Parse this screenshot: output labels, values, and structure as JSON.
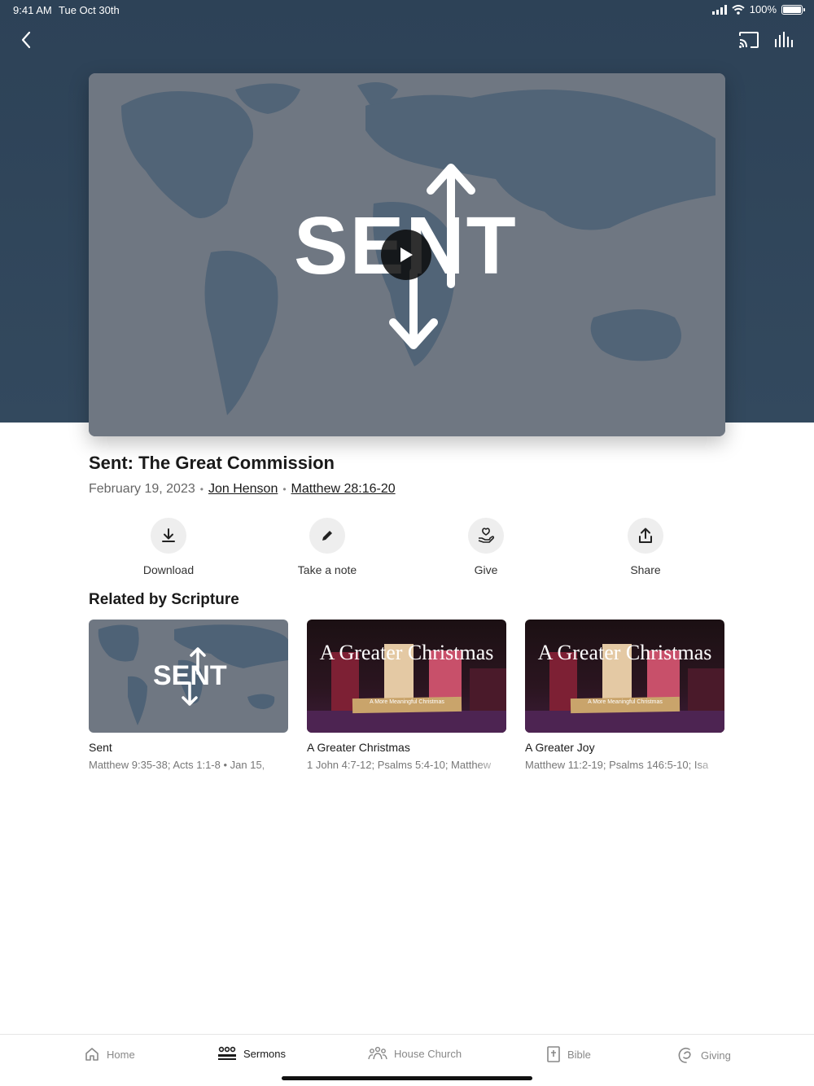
{
  "status": {
    "time": "9:41 AM",
    "date": "Tue Oct 30th",
    "battery": "100%"
  },
  "hero": {
    "artwork_text": "SENT",
    "play_icon": "play-icon"
  },
  "sermon": {
    "title": "Sent: The Great Commission",
    "date": "February 19, 2023",
    "speaker": "Jon Henson",
    "scripture": "Matthew 28:16-20"
  },
  "actions": [
    {
      "label": "Download",
      "icon": "download-icon"
    },
    {
      "label": "Take a note",
      "icon": "pencil-icon"
    },
    {
      "label": "Give",
      "icon": "give-icon"
    },
    {
      "label": "Share",
      "icon": "share-icon"
    }
  ],
  "related": {
    "heading": "Related by Scripture",
    "items": [
      {
        "title": "Sent",
        "subtitle": "Matthew 9:35-38; Acts 1:1-8 • Jan 15,",
        "art_text": "SENT"
      },
      {
        "title": "A Greater Christmas",
        "subtitle": "1 John 4:7-12; Psalms 5:4-10; Matthew",
        "art_title": "A Greater Christmas",
        "art_sub": "A More Meaningful Christmas"
      },
      {
        "title": "A Greater Joy",
        "subtitle": "Matthew 11:2-19; Psalms 146:5-10; Isa",
        "art_title": "A Greater Christmas",
        "art_sub": "A More Meaningful Christmas"
      }
    ]
  },
  "tabs": [
    {
      "label": "Home",
      "icon": "home-icon",
      "active": false
    },
    {
      "label": "Sermons",
      "icon": "sermons-icon",
      "active": true
    },
    {
      "label": "House Church",
      "icon": "house-church-icon",
      "active": false
    },
    {
      "label": "Bible",
      "icon": "bible-icon",
      "active": false
    },
    {
      "label": "Giving",
      "icon": "giving-icon",
      "active": false
    }
  ],
  "colors": {
    "hero_bg": "#2d4257",
    "artwork_bg": "#6f7782",
    "active_tab": "#1a1a1a"
  }
}
